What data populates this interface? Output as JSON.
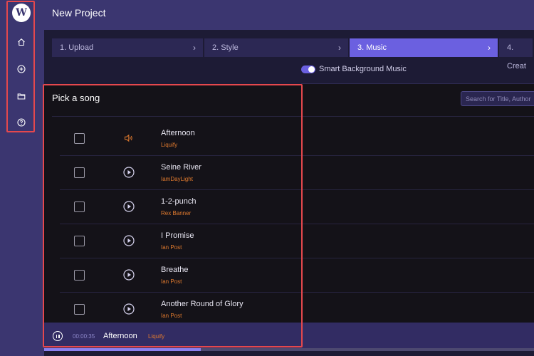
{
  "header": {
    "title": "New Project"
  },
  "steps": [
    {
      "label": "1. Upload",
      "state": "done"
    },
    {
      "label": "2. Style",
      "state": "done"
    },
    {
      "label": "3. Music",
      "state": "active"
    },
    {
      "label": "4. Creat",
      "state": "pending"
    }
  ],
  "toggle": {
    "label": "Smart Background Music",
    "enabled": true
  },
  "panel": {
    "title": "Pick a song",
    "search_placeholder": "Search for Title, Author"
  },
  "songs": [
    {
      "name": "Afternoon",
      "artist": "Liquify",
      "icon": "speaker-icon",
      "playing": true
    },
    {
      "name": "Seine River",
      "artist": "IamDayLight",
      "icon": "play-icon",
      "playing": false
    },
    {
      "name": "1-2-punch",
      "artist": "Rex Banner",
      "icon": "play-icon",
      "playing": false
    },
    {
      "name": "I Promise",
      "artist": "Ian Post",
      "icon": "play-icon",
      "playing": false
    },
    {
      "name": "Breathe",
      "artist": "Ian Post",
      "icon": "play-icon",
      "playing": false
    },
    {
      "name": "Another Round of Glory",
      "artist": "Ian Post",
      "icon": "play-icon",
      "playing": false
    }
  ],
  "player": {
    "time": "00:00:35",
    "title": "Afternoon",
    "artist": "Liquify",
    "progress_fraction": 0.32
  },
  "logo": {
    "letter": "W"
  },
  "colors": {
    "sidebar": "#3b3670",
    "accent": "#6b60e0",
    "artist": "#e07a2e",
    "highlight": "#e5484d"
  }
}
